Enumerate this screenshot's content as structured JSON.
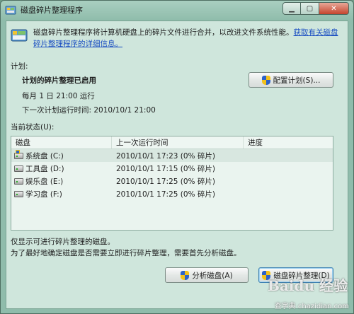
{
  "window": {
    "title": "磁盘碎片整理程序",
    "min_icon": "minimize-icon",
    "max_icon": "maximize-icon",
    "close_icon": "close-icon"
  },
  "description": {
    "text": "磁盘碎片整理程序将计算机硬盘上的碎片文件进行合并，以改进文件系统性能。",
    "link": "获取有关磁盘碎片整理程序的详细信息。"
  },
  "schedule": {
    "section_label": "计划:",
    "status_title": "计划的碎片整理已启用",
    "run_line": "每月 1 日 21:00 运行",
    "next_run_line": "下一次计划运行时间: 2010/10/1 21:00",
    "configure_button": "配置计划(S)..."
  },
  "current_status": {
    "section_label": "当前状态(U):",
    "columns": [
      "磁盘",
      "上一次运行时间",
      "进度"
    ],
    "rows": [
      {
        "disk": "系统盘 (C:)",
        "last_run": "2010/10/1 17:23 (0% 碎片)",
        "progress": "",
        "icon": "system-drive-icon"
      },
      {
        "disk": "工具盘 (D:)",
        "last_run": "2010/10/1 17:15 (0% 碎片)",
        "progress": "",
        "icon": "drive-icon"
      },
      {
        "disk": "娱乐盘 (E:)",
        "last_run": "2010/10/1 17:25 (0% 碎片)",
        "progress": "",
        "icon": "drive-icon"
      },
      {
        "disk": "学习盘 (F:)",
        "last_run": "2010/10/1 17:25 (0% 碎片)",
        "progress": "",
        "icon": "drive-icon"
      }
    ]
  },
  "notes": {
    "line1": "仅显示可进行碎片整理的磁盘。",
    "line2": "为了最好地确定磁盘是否需要立即进行碎片整理，需要首先分析磁盘。"
  },
  "buttons": {
    "analyze": "分析磁盘(A)",
    "defrag": "磁盘碎片整理(D)"
  },
  "watermark": {
    "brand": "Baidu 经验",
    "site": "jingyan.baidu.com",
    "tutorial": "教程",
    "site2": "查字典 chazidian.com"
  }
}
